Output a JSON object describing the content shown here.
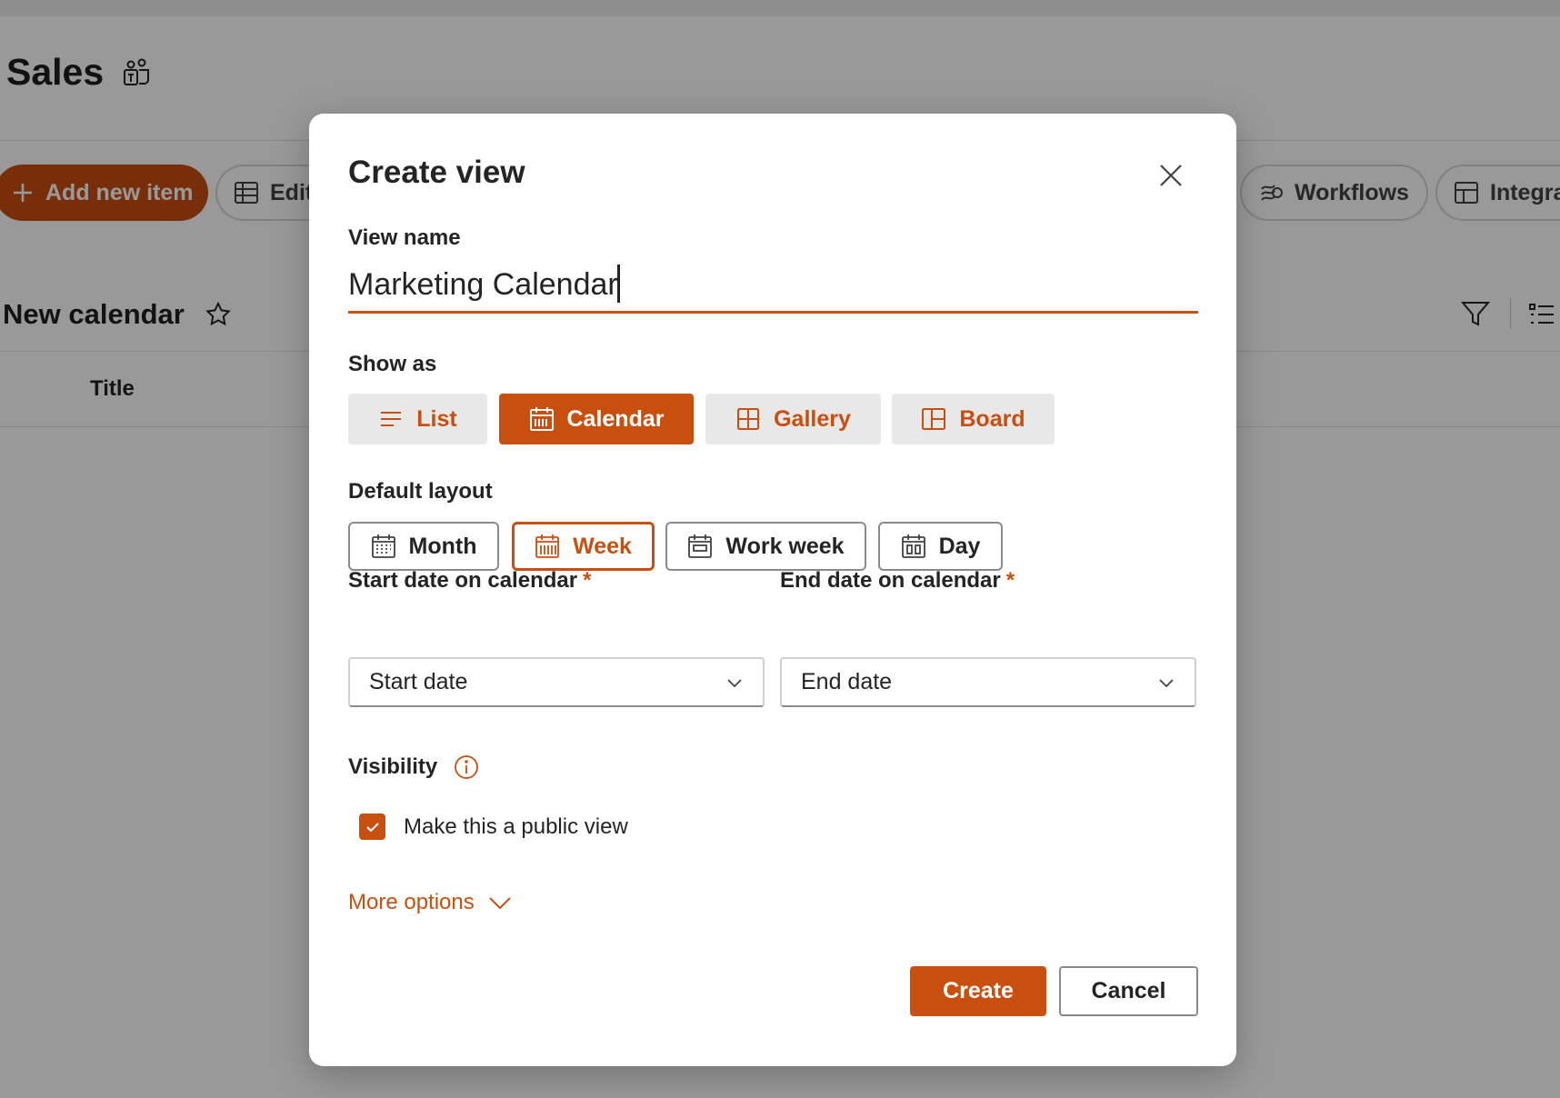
{
  "background": {
    "site_title": "Sales",
    "command_bar": {
      "add_new_item": "Add new item",
      "edit": "Edit",
      "workflows": "Workflows",
      "integrate": "Integra"
    },
    "view_title": "New calendar",
    "column_header": "Title"
  },
  "dialog": {
    "title": "Create view",
    "view_name_label": "View name",
    "view_name_value": "Marketing Calendar",
    "show_as_label": "Show as",
    "show_as_options": [
      {
        "label": "List",
        "icon": "list-icon",
        "selected": false
      },
      {
        "label": "Calendar",
        "icon": "calendar-icon",
        "selected": true
      },
      {
        "label": "Gallery",
        "icon": "gallery-icon",
        "selected": false
      },
      {
        "label": "Board",
        "icon": "board-icon",
        "selected": false
      }
    ],
    "default_layout_label": "Default layout",
    "layout_options": [
      {
        "label": "Month",
        "icon": "month-icon",
        "selected": false
      },
      {
        "label": "Week",
        "icon": "week-icon",
        "selected": true
      },
      {
        "label": "Work week",
        "icon": "work-week-icon",
        "selected": false
      },
      {
        "label": "Day",
        "icon": "day-icon",
        "selected": false
      }
    ],
    "start_date_label": "Start date on calendar",
    "start_date_value": "Start date",
    "end_date_label": "End date on calendar",
    "end_date_value": "End date",
    "required_marker": "*",
    "visibility_label": "Visibility",
    "public_view_label": "Make this a public view",
    "public_view_checked": true,
    "more_options": "More options",
    "create_button": "Create",
    "cancel_button": "Cancel"
  },
  "colors": {
    "accent": "#c94f0f",
    "overlay": "rgba(0,0,0,0.40)"
  }
}
